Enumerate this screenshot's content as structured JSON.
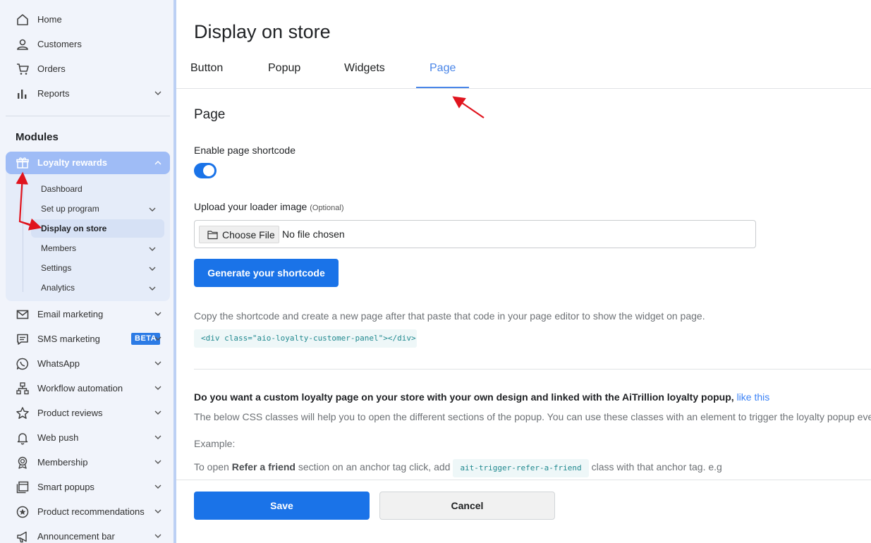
{
  "sidebar": {
    "top_items": [
      {
        "label": "Home",
        "icon": "home-icon"
      },
      {
        "label": "Customers",
        "icon": "user-icon"
      },
      {
        "label": "Orders",
        "icon": "cart-icon"
      },
      {
        "label": "Reports",
        "icon": "bar-chart-icon"
      }
    ],
    "modules_title": "Modules",
    "loyalty": {
      "label": "Loyalty rewards",
      "icon": "gift-icon",
      "sub_items": [
        {
          "label": "Dashboard"
        },
        {
          "label": "Set up program"
        },
        {
          "label": "Display on store",
          "active": true
        },
        {
          "label": "Members"
        },
        {
          "label": "Settings"
        },
        {
          "label": "Analytics"
        }
      ]
    },
    "module_items": [
      {
        "label": "Email marketing",
        "icon": "mail-icon"
      },
      {
        "label": "SMS marketing",
        "icon": "chat-icon",
        "badge": "BETA"
      },
      {
        "label": "WhatsApp",
        "icon": "whatsapp-icon"
      },
      {
        "label": "Workflow automation",
        "icon": "workflow-icon"
      },
      {
        "label": "Product reviews",
        "icon": "star-icon"
      },
      {
        "label": "Web push",
        "icon": "bell-icon"
      },
      {
        "label": "Membership",
        "icon": "badge-icon"
      },
      {
        "label": "Smart popups",
        "icon": "popup-icon"
      },
      {
        "label": "Product recommendations",
        "icon": "recommend-icon"
      },
      {
        "label": "Announcement bar",
        "icon": "megaphone-icon"
      }
    ]
  },
  "main": {
    "title": "Display on store",
    "tabs": [
      {
        "label": "Button"
      },
      {
        "label": "Popup"
      },
      {
        "label": "Widgets"
      },
      {
        "label": "Page",
        "active": true
      }
    ],
    "section_title": "Page",
    "enable_label": "Enable page shortcode",
    "toggle_on": true,
    "upload_label": "Upload your loader image",
    "upload_optional": "(Optional)",
    "choose_file_label": "Choose File",
    "file_status": "No file chosen",
    "generate_label": "Generate your shortcode",
    "copy_desc": "Copy the shortcode and create a new page after that paste that code in your page editor to show the widget on page.",
    "shortcode": "<div class=\"aio-loyalty-customer-panel\"></div>",
    "custom_question": "Do you want a custom loyalty page on your store with your own design and linked with the AiTrillion loyalty popup, ",
    "like_this_link": "like this",
    "css_desc": "The below CSS classes will help you to open the different sections of the popup. You can use these classes with an element to trigger the loyalty popup event.",
    "example_label": "Example:",
    "refer_prefix": "To open ",
    "refer_bold": "Refer a friend",
    "refer_middle": " section on an anchor tag click, add",
    "refer_code": "ait-trigger-refer-a-friend",
    "refer_suffix": "class with that anchor tag. e.g",
    "save_label": "Save",
    "cancel_label": "Cancel"
  },
  "colors": {
    "primary": "#1a73e8",
    "tab_active": "#4a86e8",
    "annotation_arrow": "#e0141e"
  }
}
